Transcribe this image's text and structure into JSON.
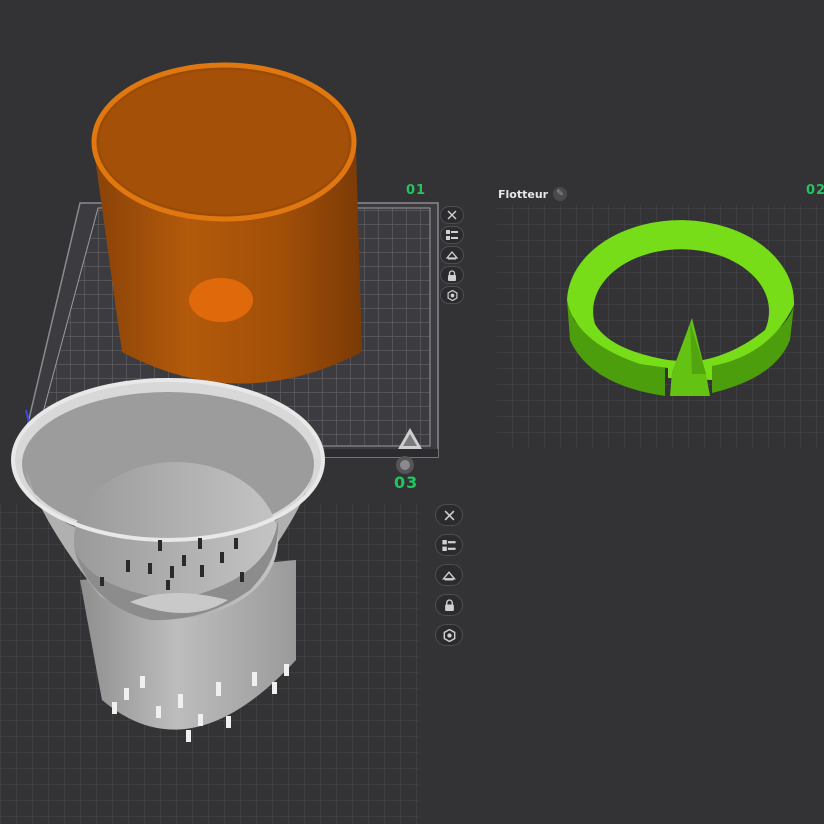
{
  "plates": [
    {
      "number": "01"
    },
    {
      "number": "02",
      "name": "Flotteur"
    },
    {
      "number": "03"
    }
  ],
  "plate_toolbar": [
    {
      "icon": "close-icon",
      "action": "remove-plate"
    },
    {
      "icon": "arrange-icon",
      "action": "arrange-objects"
    },
    {
      "icon": "auto-orient-icon",
      "action": "auto-orient"
    },
    {
      "icon": "lock-icon",
      "action": "lock-plate"
    },
    {
      "icon": "plate-settings-icon",
      "action": "plate-settings"
    }
  ],
  "colors": {
    "background": "#333336",
    "grid": "#505054",
    "plate_number": "#22c55e",
    "model_orange": "#b85c0a",
    "model_green": "#66cc11",
    "model_gray": "#b8b8b8"
  }
}
